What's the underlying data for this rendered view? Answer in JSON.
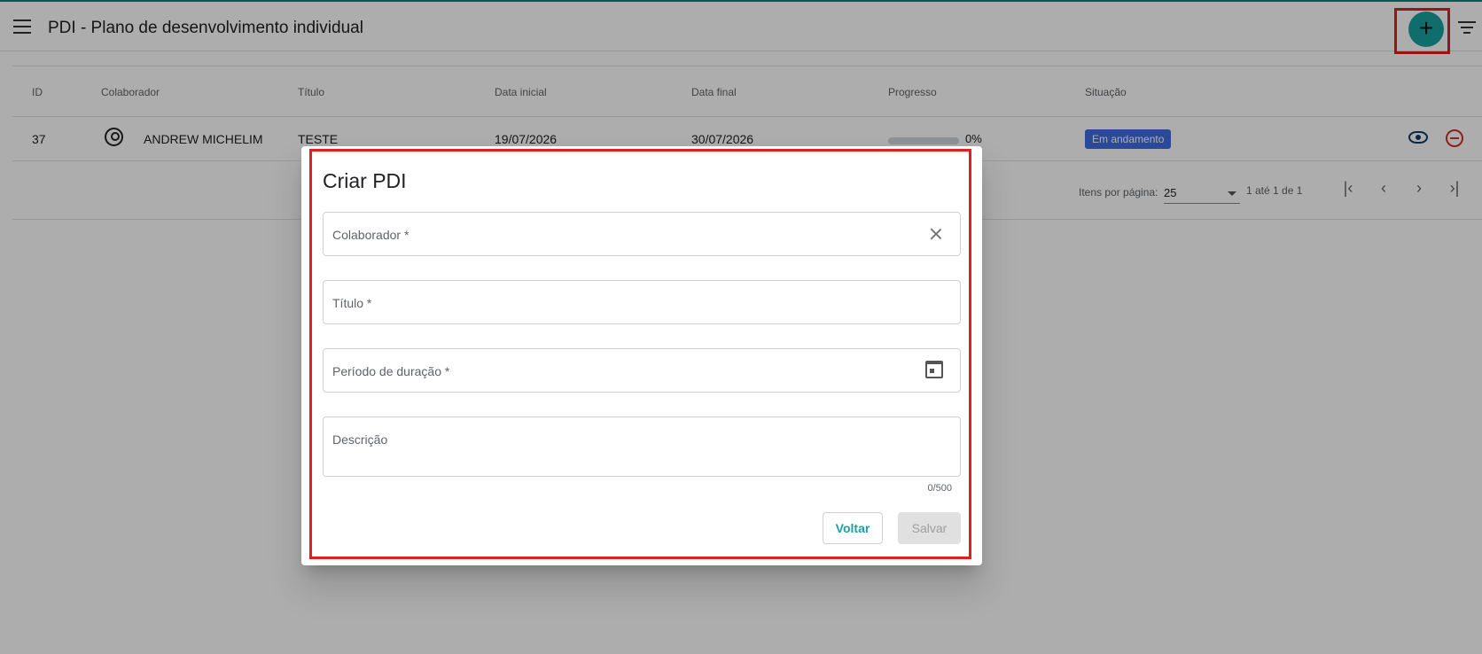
{
  "header": {
    "title": "PDI - Plano de desenvolvimento individual",
    "add_label": "+"
  },
  "table": {
    "columns": [
      "ID",
      "Colaborador",
      "Título",
      "Data inicial",
      "Data final",
      "Progresso",
      "Situação"
    ],
    "rows": [
      {
        "id": "37",
        "colaborador": "ANDREW MICHELIM",
        "titulo": "TESTE",
        "data_inicial": "19/07/2026",
        "data_final": "30/07/2026",
        "progresso": "0%",
        "progress_fraction": 0,
        "situacao": "Em andamento"
      }
    ]
  },
  "pagination": {
    "items_per_page_label": "Itens por página:",
    "page_size": "25",
    "range_label": "1 até 1 de 1",
    "buttons": [
      "first-page",
      "previous-page",
      "next-page",
      "last-page"
    ]
  },
  "modal": {
    "title": "Criar PDI",
    "fields": {
      "colaborador": {
        "label": "Colaborador *",
        "value": ""
      },
      "titulo": {
        "label": "Título *",
        "value": ""
      },
      "periodo": {
        "label": "Período de duração *",
        "value": ""
      },
      "descricao": {
        "label": "Descrição",
        "value": ""
      }
    },
    "counter": "0/500",
    "back_label": "Voltar",
    "save_label": "Salvar"
  },
  "colors": {
    "accent": "#17a2a0",
    "status_badge": "#3f6ce0",
    "highlight": "#e02020",
    "remove": "#d32f2f"
  },
  "icons": [
    "menu-icon",
    "add-icon",
    "filter-icon",
    "avatar-icon",
    "eye-icon",
    "remove-icon",
    "clear-icon",
    "calendar-icon",
    "chevron-down-icon"
  ]
}
